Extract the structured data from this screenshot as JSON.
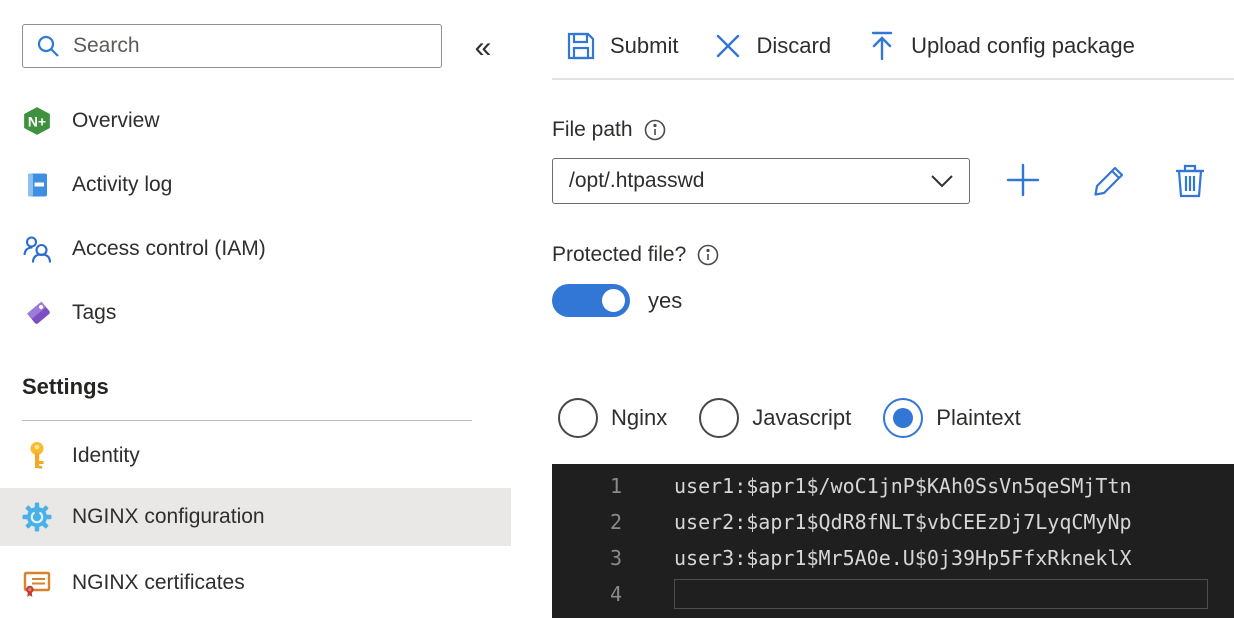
{
  "colors": {
    "accent_blue": "#3276d6",
    "editor_background": "#1f1f1f",
    "editor_text": "#d6d6d6",
    "editor_line_numbers": "#8b8b8b",
    "selected_row_background": "#e9e8e6",
    "nginx_green": "#3f9140",
    "tag_purple": "#8257c8",
    "key_gold": "#fbbc2c",
    "gear_blue": "#49b0e8",
    "certificate_orange": "#d9822b"
  },
  "sidebar": {
    "search": {
      "placeholder": "Search"
    },
    "collapse_glyph": "«",
    "items": [
      {
        "label": "Overview",
        "icon": "nginx-plus-icon"
      },
      {
        "label": "Activity log",
        "icon": "book-icon"
      },
      {
        "label": "Access control (IAM)",
        "icon": "people-icon"
      },
      {
        "label": "Tags",
        "icon": "tag-icon"
      }
    ],
    "settings": {
      "heading": "Settings",
      "items": [
        {
          "label": "Identity",
          "icon": "key-icon",
          "selected": false
        },
        {
          "label": "NGINX configuration",
          "icon": "gear-icon",
          "selected": true
        },
        {
          "label": "NGINX certificates",
          "icon": "certificate-icon",
          "selected": false
        }
      ]
    }
  },
  "toolbar": {
    "submit_label": "Submit",
    "discard_label": "Discard",
    "upload_label": "Upload config package"
  },
  "file_path": {
    "label": "File path",
    "value": "/opt/.htpasswd"
  },
  "protected_file": {
    "label": "Protected file?",
    "state_label": "yes",
    "enabled": true
  },
  "syntax_options": [
    {
      "label": "Nginx",
      "selected": false
    },
    {
      "label": "Javascript",
      "selected": false
    },
    {
      "label": "Plaintext",
      "selected": true
    }
  ],
  "editor": {
    "lines": [
      {
        "number": "1",
        "text": "user1:$apr1$/woC1jnP$KAh0SsVn5qeSMjTtn"
      },
      {
        "number": "2",
        "text": "user2:$apr1$QdR8fNLT$vbCEEzDj7LyqCMyNp"
      },
      {
        "number": "3",
        "text": "user3:$apr1$Mr5A0e.U$0j39Hp5FfxRkneklX"
      },
      {
        "number": "4",
        "text": ""
      }
    ]
  }
}
